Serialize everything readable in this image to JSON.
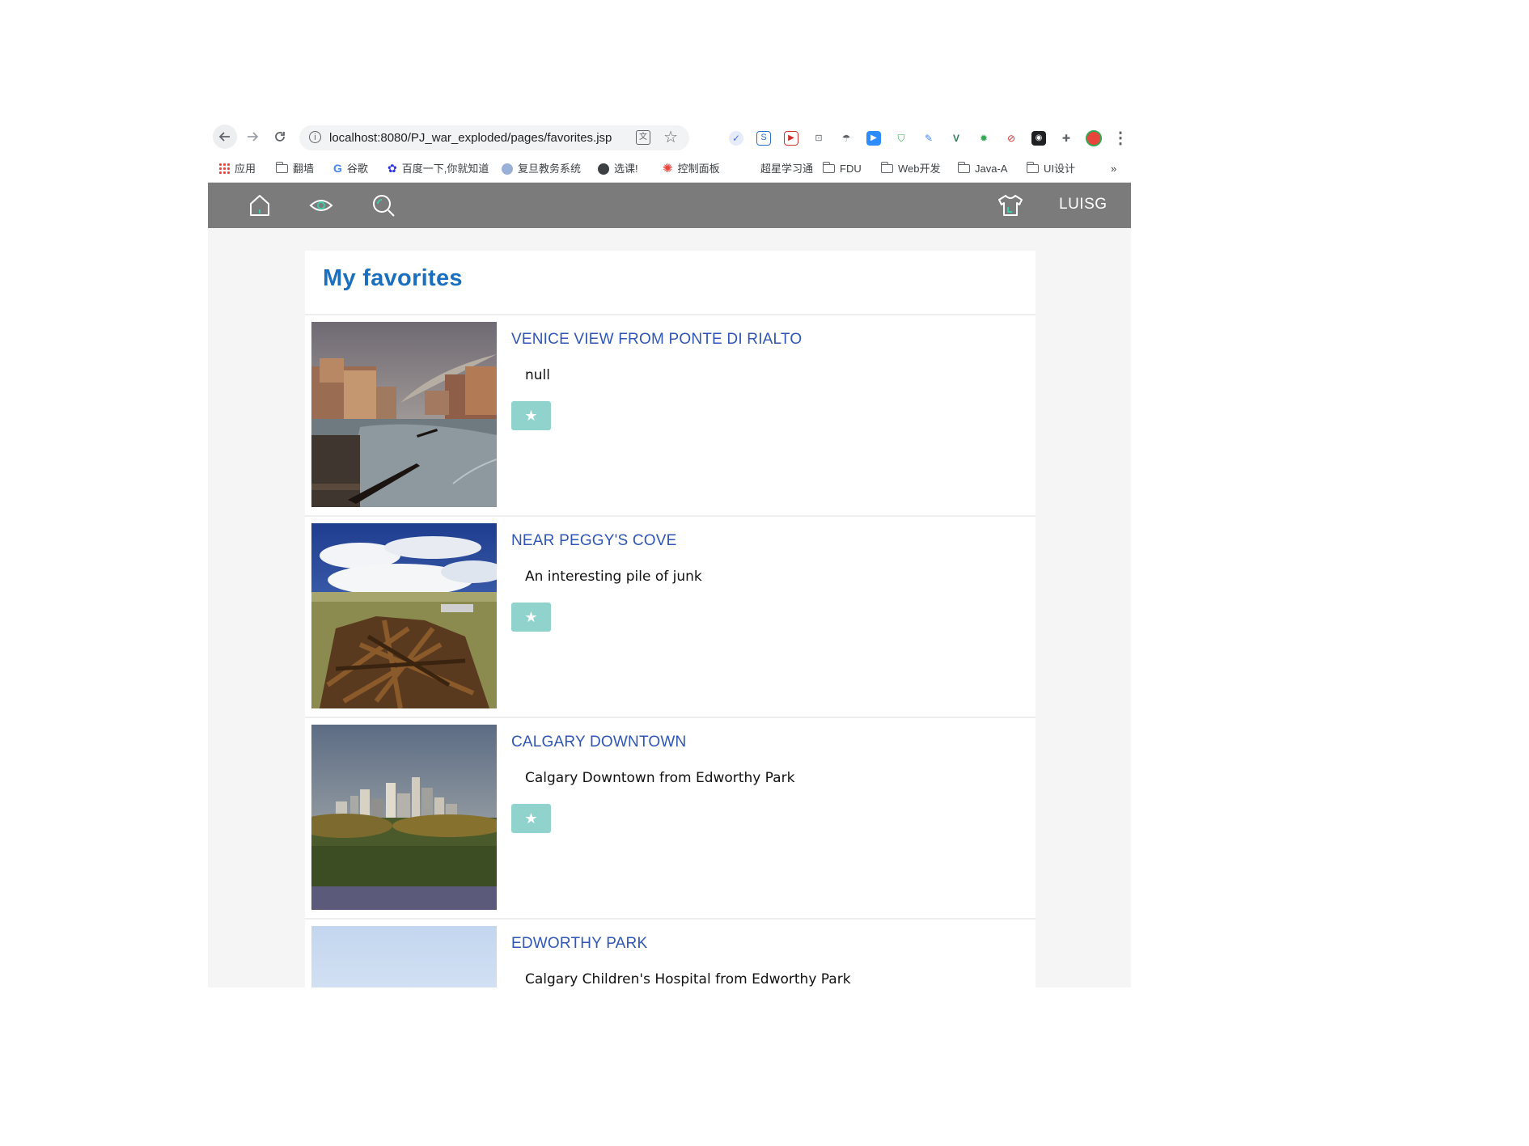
{
  "browser": {
    "url": "localhost:8080/PJ_war_exploded/pages/favorites.jsp",
    "bookmarks": [
      {
        "label": "应用",
        "icon": "apps-grid-icon"
      },
      {
        "label": "翻墙",
        "icon": "folder-icon"
      },
      {
        "label": "谷歌",
        "icon": "google-icon"
      },
      {
        "label": "百度一下,你就知道",
        "icon": "baidu-icon"
      },
      {
        "label": "复旦教务系统",
        "icon": "fudan-icon"
      },
      {
        "label": "选课!",
        "icon": "globe-icon"
      },
      {
        "label": "控制面板",
        "icon": "settings-icon"
      },
      {
        "label": "超星学习通",
        "icon": ""
      },
      {
        "label": "FDU",
        "icon": "folder-icon"
      },
      {
        "label": "Web开发",
        "icon": "folder-icon"
      },
      {
        "label": "Java-A",
        "icon": "folder-icon"
      },
      {
        "label": "UI设计",
        "icon": "folder-icon"
      }
    ],
    "overflow_label": "»"
  },
  "site_nav": {
    "user_name": "LUISG",
    "icons": [
      "home-icon",
      "eye-icon",
      "search-icon",
      "shirt-icon"
    ],
    "accent": "#3ec9a7"
  },
  "favorites": {
    "title": "My favorites",
    "items": [
      {
        "title": "VENICE VIEW FROM PONTE DI RIALTO",
        "description": "null"
      },
      {
        "title": "NEAR PEGGY'S COVE",
        "description": "An interesting pile of junk"
      },
      {
        "title": "CALGARY DOWNTOWN",
        "description": "Calgary Downtown from Edworthy Park"
      },
      {
        "title": "EDWORTHY PARK",
        "description": "Calgary Children's Hospital from Edworthy Park"
      }
    ]
  },
  "colors": {
    "title_blue": "#1a6fbe",
    "item_title_blue": "#2f56b4",
    "nav_gray": "#7b7b7b",
    "button_teal": "#8fd3cc"
  }
}
